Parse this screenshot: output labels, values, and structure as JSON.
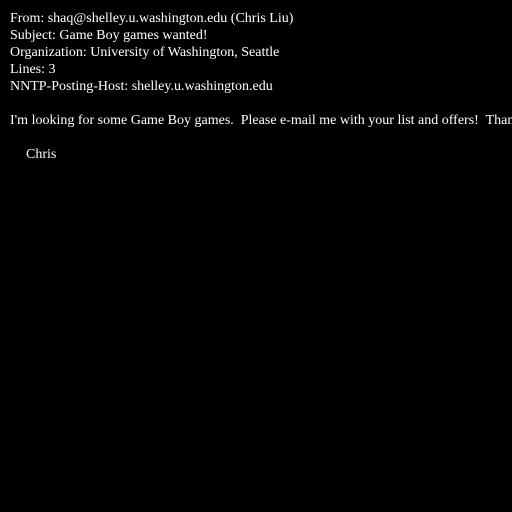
{
  "headers": {
    "from": "From: shaq@shelley.u.washington.edu (Chris Liu)",
    "subject": "Subject: Game Boy games wanted!",
    "organization": "Organization: University of Washington, Seattle",
    "lines": "Lines: 3",
    "nntp_posting_host": "NNTP-Posting-Host: shelley.u.washington.edu"
  },
  "body": {
    "text": "I'm looking for some Game Boy games.  Please e-mail me with your list and offers!  Thanks.",
    "signature": "Chris"
  },
  "colors": {
    "background": "#000000",
    "text": "#ffffff"
  }
}
